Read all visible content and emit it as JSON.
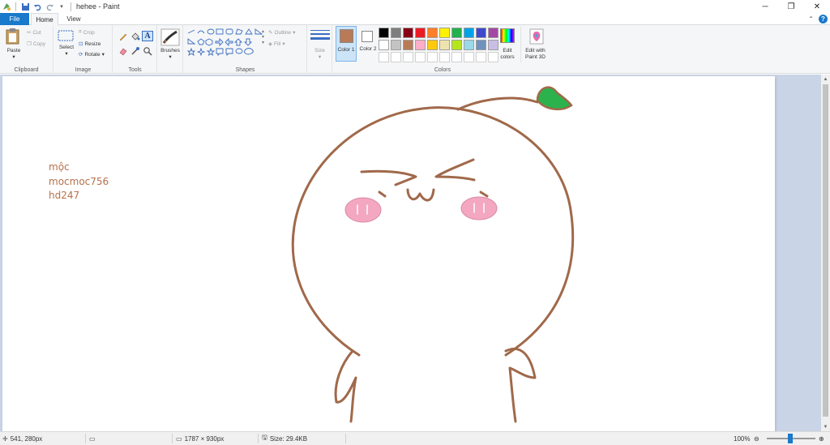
{
  "window": {
    "title": "hehee - Paint"
  },
  "tabs": {
    "file": "File",
    "home": "Home",
    "view": "View"
  },
  "ribbon": {
    "clipboard": {
      "label": "Clipboard",
      "paste": "Paste",
      "cut": "Cut",
      "copy": "Copy"
    },
    "image": {
      "label": "Image",
      "select": "Select",
      "crop": "Crop",
      "resize": "Resize",
      "rotate": "Rotate"
    },
    "tools": {
      "label": "Tools"
    },
    "brushes": {
      "label": "Brushes"
    },
    "shapes": {
      "label": "Shapes",
      "outline": "Outline",
      "fill": "Fill"
    },
    "size": {
      "label": "Size"
    },
    "colors": {
      "label": "Colors",
      "color1": "Color 1",
      "color2": "Color 2",
      "edit_colors": "Edit colors",
      "edit_paint3d": "Edit with Paint 3D",
      "color1_value": "#b97a57",
      "color2_value": "#ffffff",
      "palette_row1": [
        "#000000",
        "#7f7f7f",
        "#880015",
        "#ed1c24",
        "#ff7f27",
        "#fff200",
        "#22b14c",
        "#00a2e8",
        "#3f48cc",
        "#a349a4"
      ],
      "palette_row2": [
        "#ffffff",
        "#c3c3c3",
        "#b97a57",
        "#ffaec9",
        "#ffc90e",
        "#efe4b0",
        "#b5e61d",
        "#99d9ea",
        "#7092be",
        "#c8bfe7"
      ]
    }
  },
  "canvas": {
    "text_lines": [
      "mộc",
      "mocmoc756",
      "hd247"
    ],
    "drawing": "brown outline character with leaf and pink cheeks"
  },
  "status": {
    "cursor": "541, 280px",
    "dimensions": "1787 × 930px",
    "size": "Size: 29.4KB",
    "zoom": "100%"
  }
}
